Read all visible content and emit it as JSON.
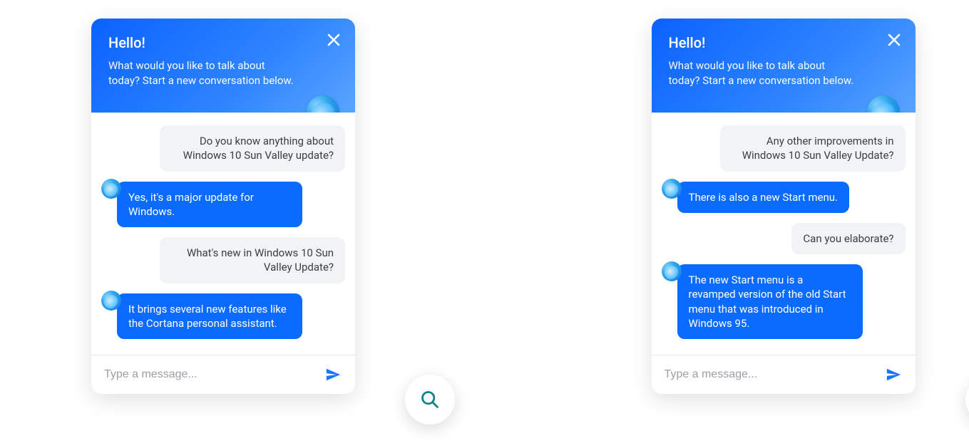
{
  "header": {
    "title": "Hello!",
    "subtitle": "What would you like to talk about today? Start a new conversation below."
  },
  "input": {
    "placeholder": "Type a message..."
  },
  "colors": {
    "accent": "#0b6bff",
    "search_icon": "#0f828a"
  },
  "chats": [
    {
      "messages": [
        {
          "role": "user",
          "text": "Do you know anything about Windows 10 Sun Valley update?"
        },
        {
          "role": "bot",
          "text": "Yes, it's a major update for Windows."
        },
        {
          "role": "user",
          "text": "What's new in Windows 10 Sun Valley Update?"
        },
        {
          "role": "bot",
          "text": "It brings several new features like the Cortana personal assistant."
        }
      ]
    },
    {
      "messages": [
        {
          "role": "user",
          "text": "Any other improvements in Windows 10 Sun Valley Update?"
        },
        {
          "role": "bot",
          "text": "There is also a new Start menu."
        },
        {
          "role": "user",
          "text": "Can you elaborate?"
        },
        {
          "role": "bot",
          "text": "The new Start menu is a revamped version of the old Start menu that was introduced in Windows 95."
        }
      ]
    }
  ]
}
